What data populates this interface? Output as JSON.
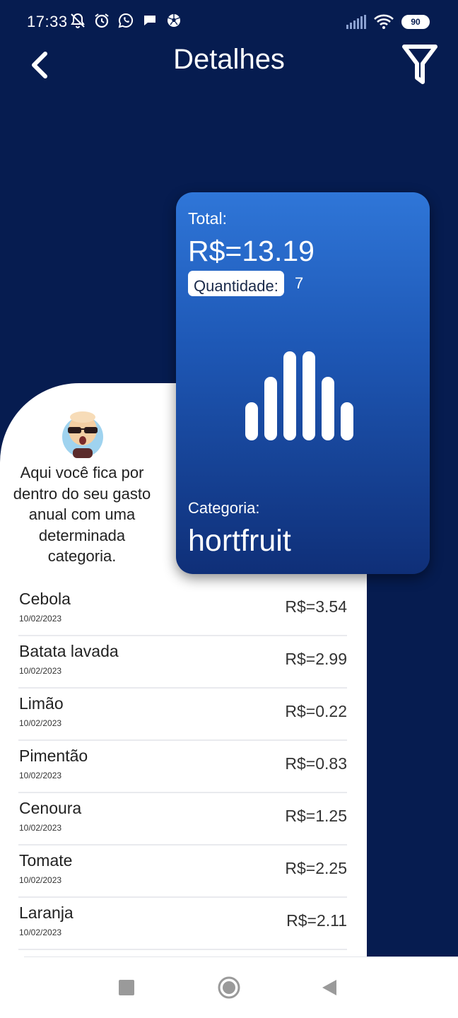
{
  "status_bar": {
    "time": "17:33",
    "battery": "90",
    "icons": [
      "notifications-off-icon",
      "alarm-icon",
      "whatsapp-icon",
      "chat-icon",
      "soccer-ball-icon",
      "signal-icon",
      "wifi-icon",
      "battery-icon"
    ]
  },
  "header": {
    "title": "Detalhes",
    "back_icon": "chevron-left-icon",
    "filter_icon": "filter-icon"
  },
  "info": {
    "text": "Aqui você fica por dentro do seu gasto anual com uma determinada categoria."
  },
  "summary": {
    "total_label": "Total:",
    "total_value": "R$=13.19",
    "quantity_label": "Quantidade:",
    "quantity_value": "7",
    "category_label": "Categoria:",
    "category_value": "hortfruit"
  },
  "items": [
    {
      "name": "Cebola",
      "date": "10/02/2023",
      "price": "R$=3.54"
    },
    {
      "name": "Batata lavada",
      "date": "10/02/2023",
      "price": "R$=2.99"
    },
    {
      "name": "Limão",
      "date": "10/02/2023",
      "price": "R$=0.22"
    },
    {
      "name": "Pimentão",
      "date": "10/02/2023",
      "price": "R$=0.83"
    },
    {
      "name": "Cenoura",
      "date": "10/02/2023",
      "price": "R$=1.25"
    },
    {
      "name": "Tomate",
      "date": "10/02/2023",
      "price": "R$=2.25"
    },
    {
      "name": "Laranja",
      "date": "10/02/2023",
      "price": "R$=2.11"
    }
  ],
  "colors": {
    "background": "#061c50",
    "card_top": "#2f76d8",
    "card_bottom": "#0f2f78",
    "panel": "#ffffff"
  }
}
